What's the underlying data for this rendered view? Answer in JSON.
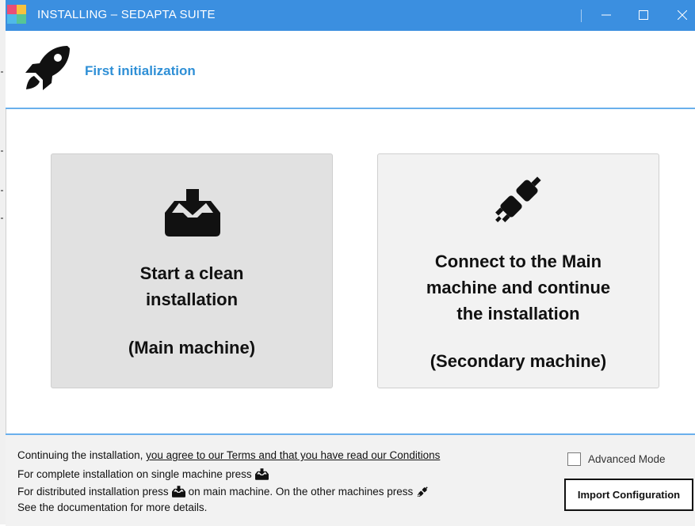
{
  "window": {
    "title": "INSTALLING – SEDAPTA SUITE",
    "controls": [
      "minimize-icon",
      "maximize-icon",
      "close-icon"
    ],
    "accent_color": "#3b8fe0"
  },
  "header": {
    "icon": "rocket-icon",
    "title": "First initialization"
  },
  "options": [
    {
      "icon": "download-tray-icon",
      "title_lines": [
        "Start a clean",
        "installation"
      ],
      "subtitle": "(Main machine)"
    },
    {
      "icon": "plug-icon",
      "title_lines": [
        "Connect to the Main",
        "machine and continue",
        "the installation"
      ],
      "subtitle": "(Secondary machine)"
    }
  ],
  "footer": {
    "terms_prefix": "Continuing the installation, ",
    "terms_link": "you agree to our Terms and that you have read our Conditions",
    "line2": "For complete installation on single machine press",
    "line3_a": "For distributed installation press",
    "line3_b": "on main machine. On the other machines press",
    "line4": "See the documentation for more details.",
    "advanced_mode_label": "Advanced Mode",
    "advanced_mode_checked": false,
    "import_button": "Import Configuration"
  }
}
